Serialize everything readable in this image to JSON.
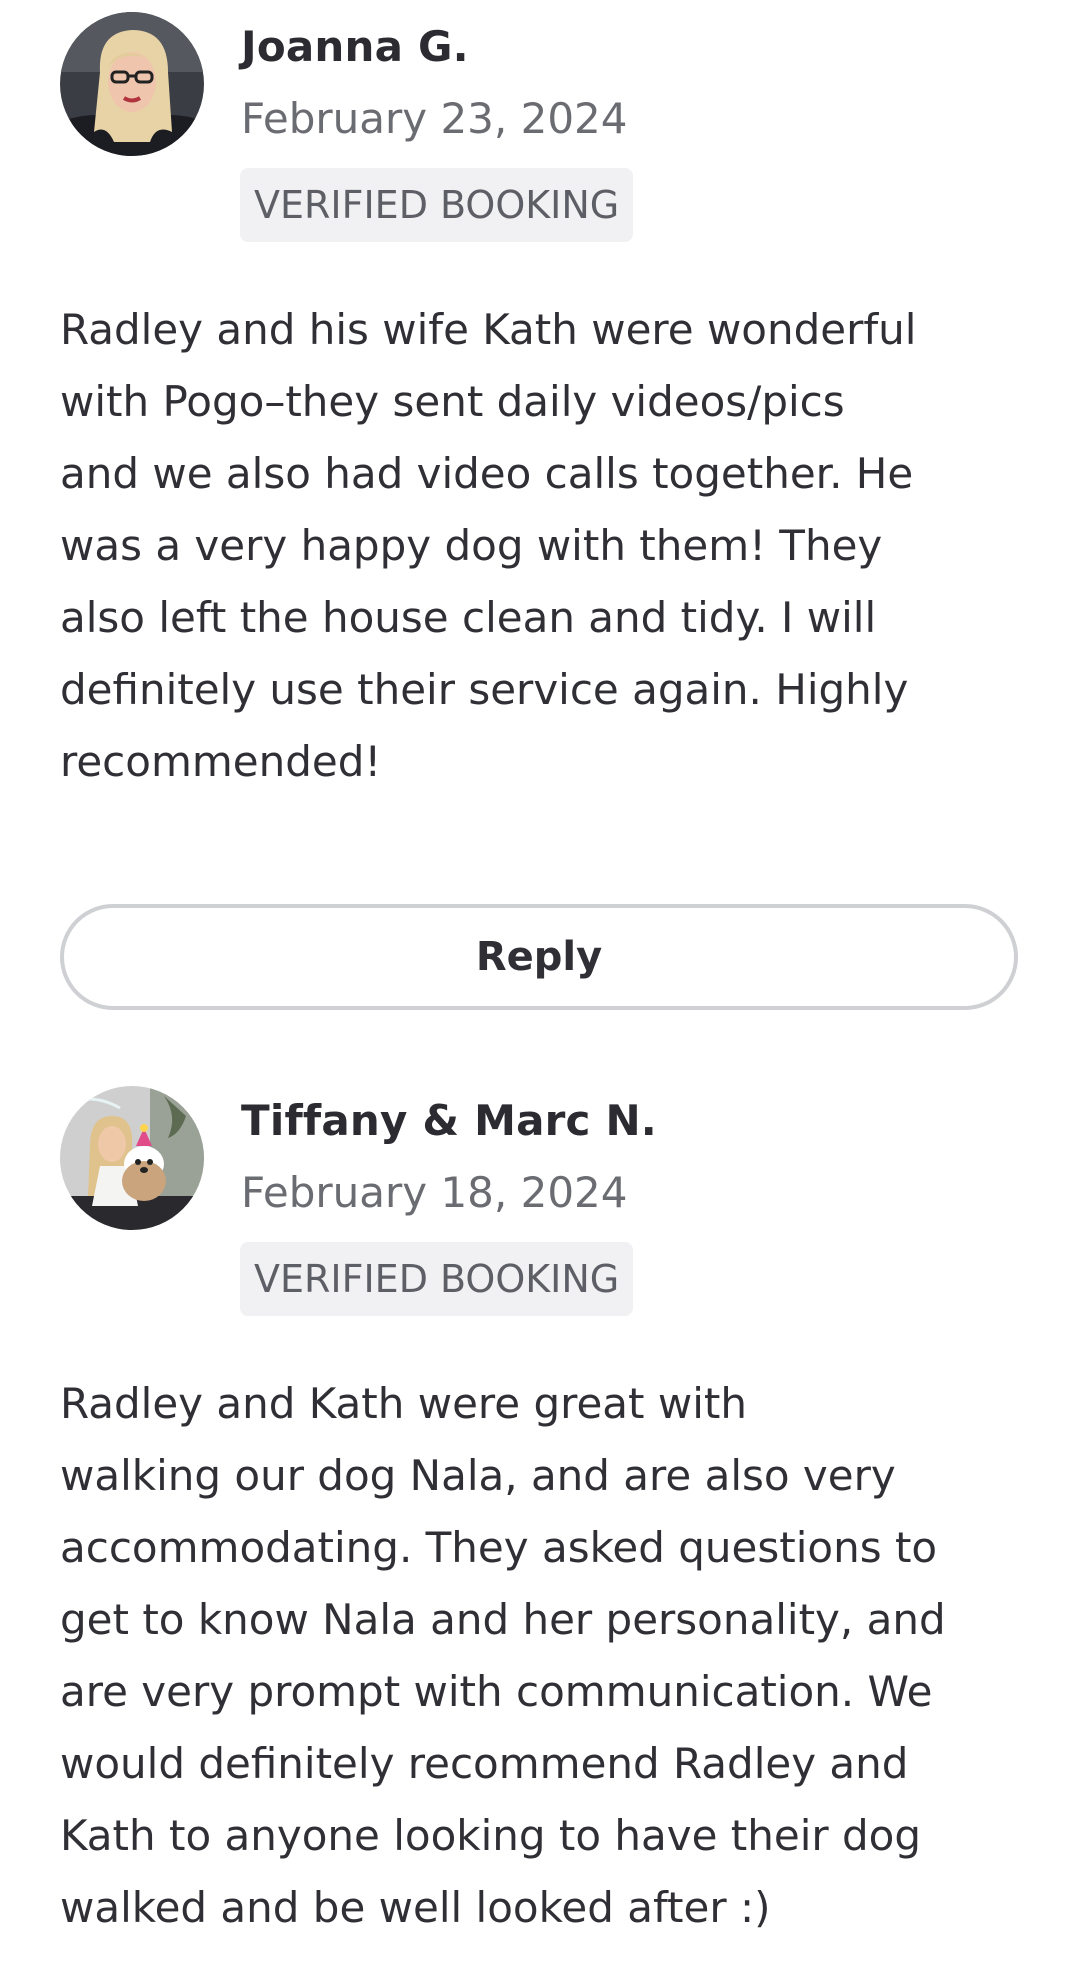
{
  "reviews": [
    {
      "reviewer_name": "Joanna G.",
      "date": "February 23, 2024",
      "badge": "VERIFIED BOOKING",
      "text_lines": [
        "Radley and his wife Kath were wonderful",
        "with Pogo–they sent daily videos/pics",
        "and we also had video calls together. He",
        "was a very happy dog with them! They",
        "also left the house clean and tidy. I will",
        "definitely use their service again. Highly",
        "recommended!"
      ],
      "reply_label": "Reply",
      "avatar_icon": "profile-photo-avatar"
    },
    {
      "reviewer_name": "Tiffany & Marc N.",
      "date": "February 18, 2024",
      "badge": "VERIFIED BOOKING",
      "text_lines": [
        "Radley and Kath were great with",
        "walking our dog Nala, and are also very",
        "accommodating. They asked questions to",
        "get to know Nala and her personality, and",
        "are very prompt with communication. We",
        "would definitely recommend Radley and",
        "Kath to anyone looking to have their dog",
        "walked and be well looked after :)"
      ],
      "avatar_icon": "profile-photo-avatar"
    }
  ],
  "colors": {
    "text": "#2f2f35",
    "muted": "#6b6c72",
    "badge_bg": "#f1f1f3",
    "button_border": "#cfd0d4"
  }
}
